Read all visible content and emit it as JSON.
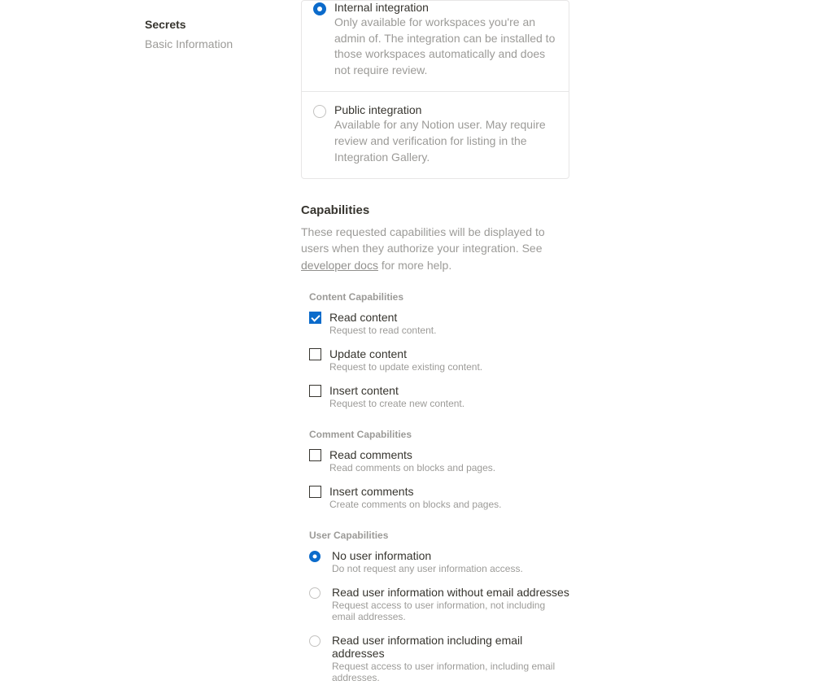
{
  "sidebar": {
    "items": [
      {
        "label": "Secrets",
        "active": true
      },
      {
        "label": "Basic Information",
        "active": false
      }
    ]
  },
  "integrationType": {
    "options": [
      {
        "title": "Internal integration",
        "desc": "Only available for workspaces you're an admin of. The integration can be installed to those workspaces automatically and does not require review.",
        "selected": true
      },
      {
        "title": "Public integration",
        "desc": "Available for any Notion user. May require review and verification for listing in the Integration Gallery.",
        "selected": false
      }
    ]
  },
  "capabilities": {
    "title": "Capabilities",
    "desc_before": "These requested capabilities will be displayed to users when they authorize your integration. See ",
    "desc_link": "developer docs",
    "desc_after": " for more help.",
    "content": {
      "title": "Content Capabilities",
      "items": [
        {
          "title": "Read content",
          "desc": "Request to read content.",
          "checked": true
        },
        {
          "title": "Update content",
          "desc": "Request to update existing content.",
          "checked": false
        },
        {
          "title": "Insert content",
          "desc": "Request to create new content.",
          "checked": false
        }
      ]
    },
    "comment": {
      "title": "Comment Capabilities",
      "items": [
        {
          "title": "Read comments",
          "desc": "Read comments on blocks and pages.",
          "checked": false
        },
        {
          "title": "Insert comments",
          "desc": "Create comments on blocks and pages.",
          "checked": false
        }
      ]
    },
    "user": {
      "title": "User Capabilities",
      "items": [
        {
          "title": "No user information",
          "desc": "Do not request any user information access.",
          "selected": true
        },
        {
          "title": "Read user information without email addresses",
          "desc": "Request access to user information, not including email addresses.",
          "selected": false
        },
        {
          "title": "Read user information including email addresses",
          "desc": "Request access to user information, including email addresses.",
          "selected": false
        }
      ]
    }
  }
}
